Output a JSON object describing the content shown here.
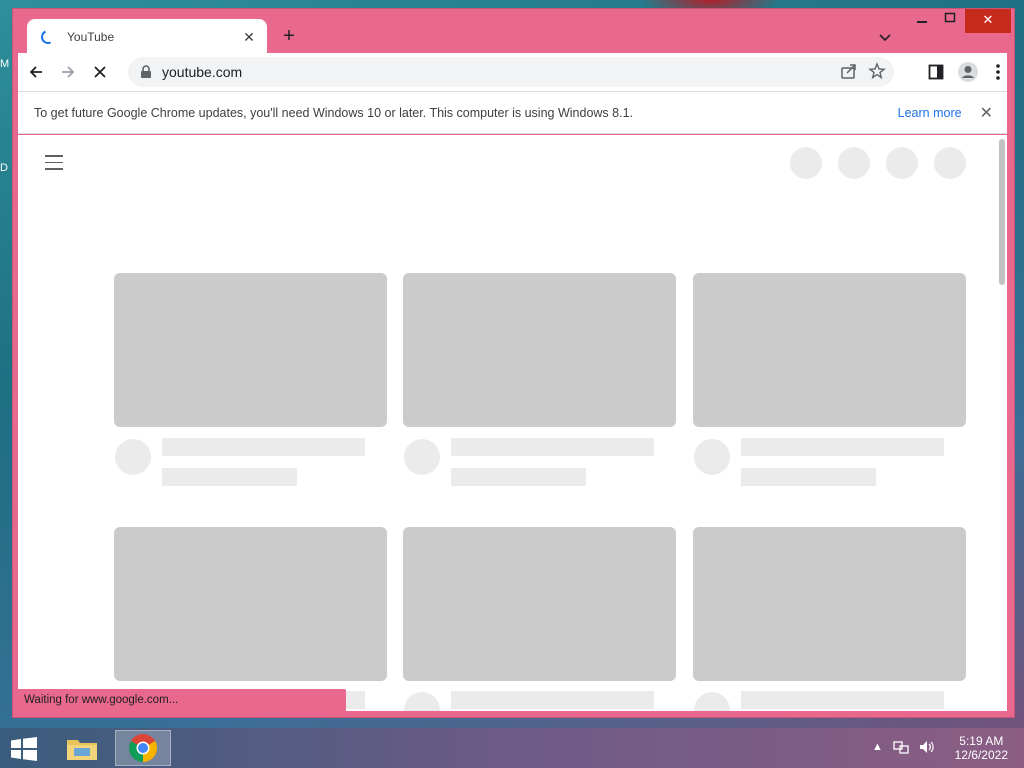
{
  "desktop": {
    "icon_label_1": "M",
    "icon_label_2": "D"
  },
  "browser": {
    "tab": {
      "title": "YouTube"
    },
    "omnibox": {
      "url": "youtube.com"
    },
    "infobar": {
      "message": "To get future Google Chrome updates, you'll need Windows 10 or later. This computer is using Windows 8.1.",
      "link": "Learn more"
    },
    "status_text": "Waiting for www.google.com..."
  },
  "taskbar": {
    "time": "5:19 AM",
    "date": "12/6/2022"
  },
  "colors": {
    "window_frame": "#e8688e",
    "skeleton_thumb": "#cbcbcb",
    "skeleton_line": "#ebebeb",
    "link": "#1a73e8"
  }
}
